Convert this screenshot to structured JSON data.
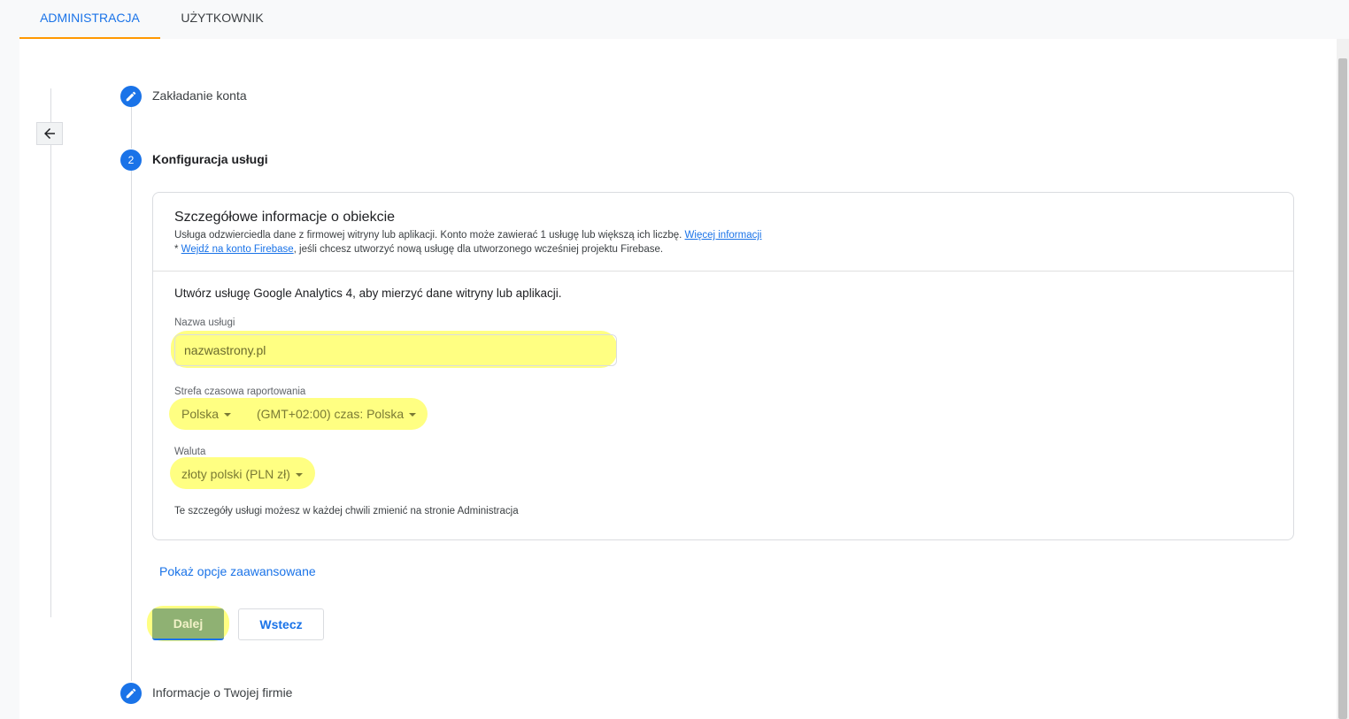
{
  "tabs": [
    {
      "label": "ADMINISTRACJA",
      "active": true
    },
    {
      "label": "UŻYTKOWNIK",
      "active": false
    }
  ],
  "steps": [
    {
      "label": "Zakładanie konta",
      "icon": "pencil-icon"
    },
    {
      "label": "Konfiguracja usługi",
      "number": "2",
      "active": true
    },
    {
      "label": "Informacje o Twojej firmie",
      "icon": "pencil-icon"
    }
  ],
  "card": {
    "title": "Szczegółowe informacje o obiekcie",
    "description": "Usługa odzwierciedla dane z firmowej witryny lub aplikacji. Konto może zawierać 1 usługę lub większą ich liczbę.",
    "more_info_link": "Więcej informacji",
    "firebase_prefix": "* ",
    "firebase_link": "Wejdź na konto Firebase",
    "firebase_suffix": ", jeśli chcesz utworzyć nową usługę dla utworzonego wcześniej projektu Firebase.",
    "intro": "Utwórz usługę Google Analytics 4, aby mierzyć dane witryny lub aplikacji.",
    "property_name": {
      "label": "Nazwa usługi",
      "value": "nazwastrony.pl"
    },
    "timezone": {
      "label": "Strefa czasowa raportowania",
      "country": "Polska",
      "zone": "(GMT+02:00) czas: Polska"
    },
    "currency": {
      "label": "Waluta",
      "value": "złoty polski (PLN zł)"
    },
    "footnote": "Te szczegóły usługi możesz w każdej chwili zmienić na stronie Administracja"
  },
  "advanced_link": "Pokaż opcje zaawansowane",
  "buttons": {
    "next": "Dalej",
    "back": "Wstecz"
  },
  "colors": {
    "accent": "#1a73e8",
    "tab_underline": "#ff9800",
    "highlight": "#ffff82",
    "next_button": "#8fb173"
  }
}
